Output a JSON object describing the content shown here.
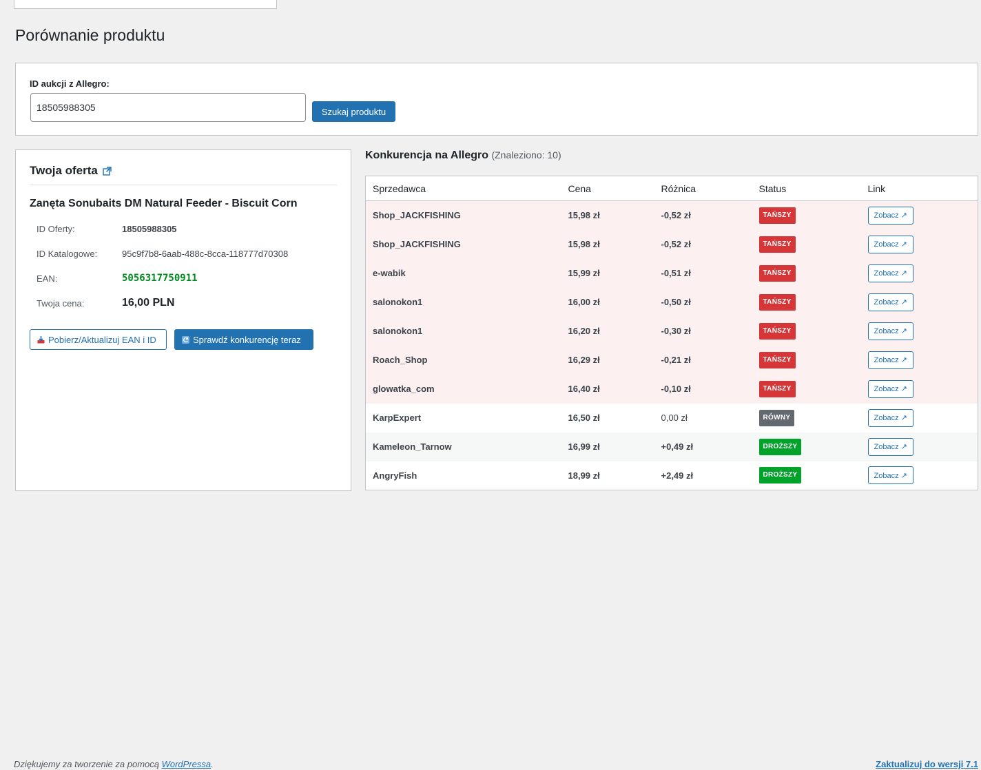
{
  "page": {
    "title": "Porównanie produktu"
  },
  "search": {
    "label": "ID aukcji z Allegro:",
    "value": "18505988305",
    "button_label": "Szukaj produktu"
  },
  "offer": {
    "heading": "Twoja oferta",
    "product_name": "Zanęta Sonubaits DM Natural Feeder - Biscuit Corn",
    "fields": [
      {
        "label": "ID Oferty:",
        "value": "18505988305"
      },
      {
        "label": "ID Katalogowe:",
        "value": "95c9f7b8-6aab-488c-8cca-118777d70308"
      },
      {
        "label": "EAN:",
        "value": "5056317750911"
      },
      {
        "label": "Twoja cena:",
        "value": "16,00 PLN"
      }
    ],
    "ean_button_label": "Pobierz/Aktualizuj EAN i ID",
    "check_button_label": "Sprawdź konkurencję teraz"
  },
  "competition": {
    "heading": "Konkurencja na Allegro",
    "found_text": "(Znaleziono: 10)",
    "columns": [
      "Sprzedawca",
      "Cena",
      "Różnica",
      "Status",
      "Link"
    ],
    "rows": [
      {
        "seller": "Shop_JACKFISHING",
        "price": "15,98 zł",
        "diff": "-0,52 zł",
        "status": "TAŃSZY",
        "link": "Zobacz ↗"
      },
      {
        "seller": "Shop_JACKFISHING",
        "price": "15,98 zł",
        "diff": "-0,52 zł",
        "status": "TAŃSZY",
        "link": "Zobacz ↗"
      },
      {
        "seller": "e-wabik",
        "price": "15,99 zł",
        "diff": "-0,51 zł",
        "status": "TAŃSZY",
        "link": "Zobacz ↗"
      },
      {
        "seller": "salonokon1",
        "price": "16,00 zł",
        "diff": "-0,50 zł",
        "status": "TAŃSZY",
        "link": "Zobacz ↗"
      },
      {
        "seller": "salonokon1",
        "price": "16,20 zł",
        "diff": "-0,30 zł",
        "status": "TAŃSZY",
        "link": "Zobacz ↗"
      },
      {
        "seller": "Roach_Shop",
        "price": "16,29 zł",
        "diff": "-0,21 zł",
        "status": "TAŃSZY",
        "link": "Zobacz ↗"
      },
      {
        "seller": "glowatka_com",
        "price": "16,40 zł",
        "diff": "-0,10 zł",
        "status": "TAŃSZY",
        "link": "Zobacz ↗"
      },
      {
        "seller": "KarpExpert",
        "price": "16,50 zł",
        "diff": "0,00 zł",
        "status": "RÓWNY",
        "link": "Zobacz ↗"
      },
      {
        "seller": "Kameleon_Tarnow",
        "price": "16,99 zł",
        "diff": "+0,49 zł",
        "status": "DROŻSZY",
        "link": "Zobacz ↗"
      },
      {
        "seller": "AngryFish",
        "price": "18,99 zł",
        "diff": "+2,49 zł",
        "status": "DROŻSZY",
        "link": "Zobacz ↗"
      }
    ]
  },
  "colors": {
    "primary": "#2271b1",
    "cheaper_badge": "#d63638",
    "equal_badge": "#646970",
    "pricier_badge": "#00a32a",
    "ean_text": "#008a20"
  },
  "footer": {
    "thanks_prefix": "Dziękujemy za tworzenie za pomocą ",
    "thanks_link": "WordPressa",
    "thanks_suffix": ".",
    "update_link": "Zaktualizuj do wersji 7.1"
  }
}
